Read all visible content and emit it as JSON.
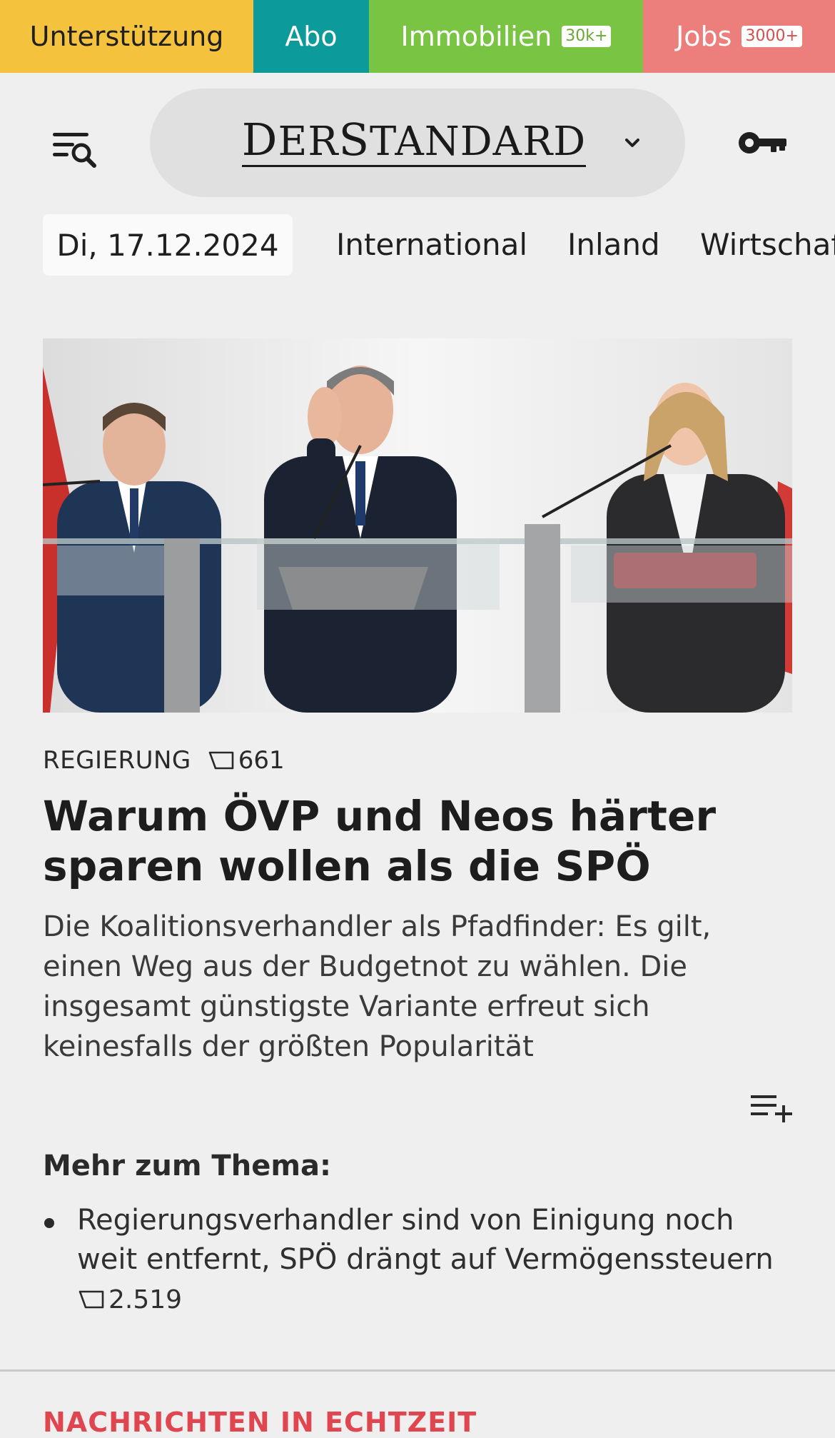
{
  "promo_bar": {
    "support_label": "Unterstützung",
    "abo_label": "Abo",
    "immobilien_label": "Immobilien",
    "immobilien_badge": "30k+",
    "jobs_label": "Jobs",
    "jobs_badge": "3000+"
  },
  "header": {
    "logo_text_d": "D",
    "logo_text_er": "ER",
    "logo_text_s": "S",
    "logo_text_tandard": "TANDARD",
    "menu_icon": "menu-search-icon",
    "chevron_icon": "chevron-down-icon",
    "account_icon": "key-icon"
  },
  "section_nav": {
    "date": "Di, 17.12.2024",
    "links": [
      "International",
      "Inland",
      "Wirtschaft"
    ]
  },
  "article": {
    "kicker": "REGIERUNG",
    "comment_count": "661",
    "headline": "Warum ÖVP und Neos härter sparen wollen als die SPÖ",
    "lede": "Die Koalitionsverhandler als Pfadfinder: Es gilt, einen Weg aus der Budgetnot zu wählen. Die insgesamt günstigste Variante erfreut sich keinesfalls der größten Popularität",
    "playlist_icon": "playlist-add-icon"
  },
  "more_on_topic": {
    "title": "Mehr zum Thema:",
    "items": [
      {
        "text": "Regierungsverhandler sind von Einigung noch weit entfernt, SPÖ drängt auf Vermögenssteuern",
        "comment_count": "2.519"
      }
    ]
  },
  "next_section": {
    "heading": "NACHRICHTEN IN ECHTZEIT"
  },
  "colors": {
    "support": "#f4c23d",
    "abo": "#0d9a9a",
    "immobilien": "#79c442",
    "jobs": "#ec7f7b",
    "live_heading": "#e0464f"
  }
}
